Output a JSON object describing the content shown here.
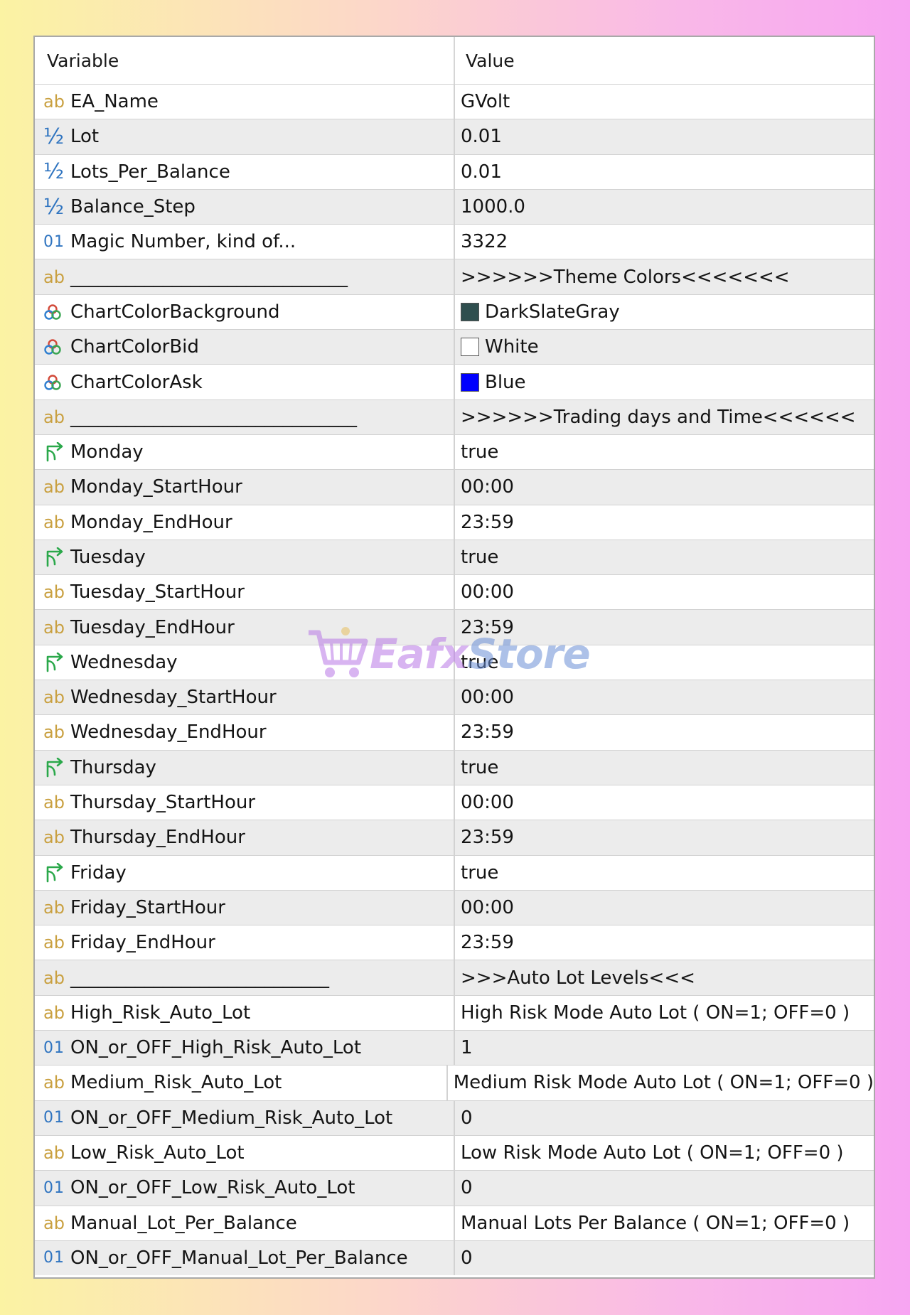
{
  "header": {
    "variable": "Variable",
    "value": "Value"
  },
  "watermark": {
    "part1": "Eafx",
    "part2": "Store"
  },
  "icons": {
    "ab": "ab",
    "double": "½",
    "int": "01"
  },
  "rows": [
    {
      "type": "ab",
      "name": "EA_Name",
      "value": "GVolt"
    },
    {
      "type": "double",
      "name": "Lot",
      "value": "0.01"
    },
    {
      "type": "double",
      "name": "Lots_Per_Balance",
      "value": "0.01"
    },
    {
      "type": "double",
      "name": "Balance_Step",
      "value": "1000.0"
    },
    {
      "type": "int",
      "name": "Magic Number, kind of...",
      "value": "3322"
    },
    {
      "type": "ab",
      "name": "______________________________",
      "value": ">>>>>>Theme Colors<<<<<<<"
    },
    {
      "type": "color",
      "name": "ChartColorBackground",
      "value": "DarkSlateGray",
      "swatch": "#2f4f4f"
    },
    {
      "type": "color",
      "name": "ChartColorBid",
      "value": "White",
      "swatch": "#ffffff"
    },
    {
      "type": "color",
      "name": "ChartColorAsk",
      "value": "Blue",
      "swatch": "#0000ff"
    },
    {
      "type": "ab",
      "name": "_______________________________",
      "value": ">>>>>>Trading days and Time<<<<<<"
    },
    {
      "type": "bool",
      "name": "Monday",
      "value": "true"
    },
    {
      "type": "ab",
      "name": "Monday_StartHour",
      "value": "00:00"
    },
    {
      "type": "ab",
      "name": "Monday_EndHour",
      "value": "23:59"
    },
    {
      "type": "bool",
      "name": "Tuesday",
      "value": "true"
    },
    {
      "type": "ab",
      "name": "Tuesday_StartHour",
      "value": "00:00"
    },
    {
      "type": "ab",
      "name": "Tuesday_EndHour",
      "value": "23:59"
    },
    {
      "type": "bool",
      "name": "Wednesday",
      "value": "true"
    },
    {
      "type": "ab",
      "name": "Wednesday_StartHour",
      "value": "00:00"
    },
    {
      "type": "ab",
      "name": "Wednesday_EndHour",
      "value": "23:59"
    },
    {
      "type": "bool",
      "name": "Thursday",
      "value": "true"
    },
    {
      "type": "ab",
      "name": "Thursday_StartHour",
      "value": "00:00"
    },
    {
      "type": "ab",
      "name": "Thursday_EndHour",
      "value": "23:59"
    },
    {
      "type": "bool",
      "name": "Friday",
      "value": "true"
    },
    {
      "type": "ab",
      "name": "Friday_StartHour",
      "value": "00:00"
    },
    {
      "type": "ab",
      "name": "Friday_EndHour",
      "value": "23:59"
    },
    {
      "type": "ab",
      "name": "____________________________",
      "value": ">>>Auto Lot Levels<<<"
    },
    {
      "type": "ab",
      "name": "High_Risk_Auto_Lot",
      "value": "High Risk Mode Auto  Lot ( ON=1; OFF=0 )"
    },
    {
      "type": "int",
      "name": "ON_or_OFF_High_Risk_Auto_Lot",
      "value": "1"
    },
    {
      "type": "ab",
      "name": "Medium_Risk_Auto_Lot",
      "value": "Medium  Risk Mode Auto  Lot ( ON=1; OFF=0 )"
    },
    {
      "type": "int",
      "name": "ON_or_OFF_Medium_Risk_Auto_Lot",
      "value": "0"
    },
    {
      "type": "ab",
      "name": "Low_Risk_Auto_Lot",
      "value": "Low Risk Mode Auto  Lot ( ON=1; OFF=0 )"
    },
    {
      "type": "int",
      "name": "ON_or_OFF_Low_Risk_Auto_Lot",
      "value": "0"
    },
    {
      "type": "ab",
      "name": "Manual_Lot_Per_Balance",
      "value": "Manual Lots Per Balance ( ON=1; OFF=0 )"
    },
    {
      "type": "int",
      "name": "ON_or_OFF_Manual_Lot_Per_Balance",
      "value": "0"
    }
  ]
}
